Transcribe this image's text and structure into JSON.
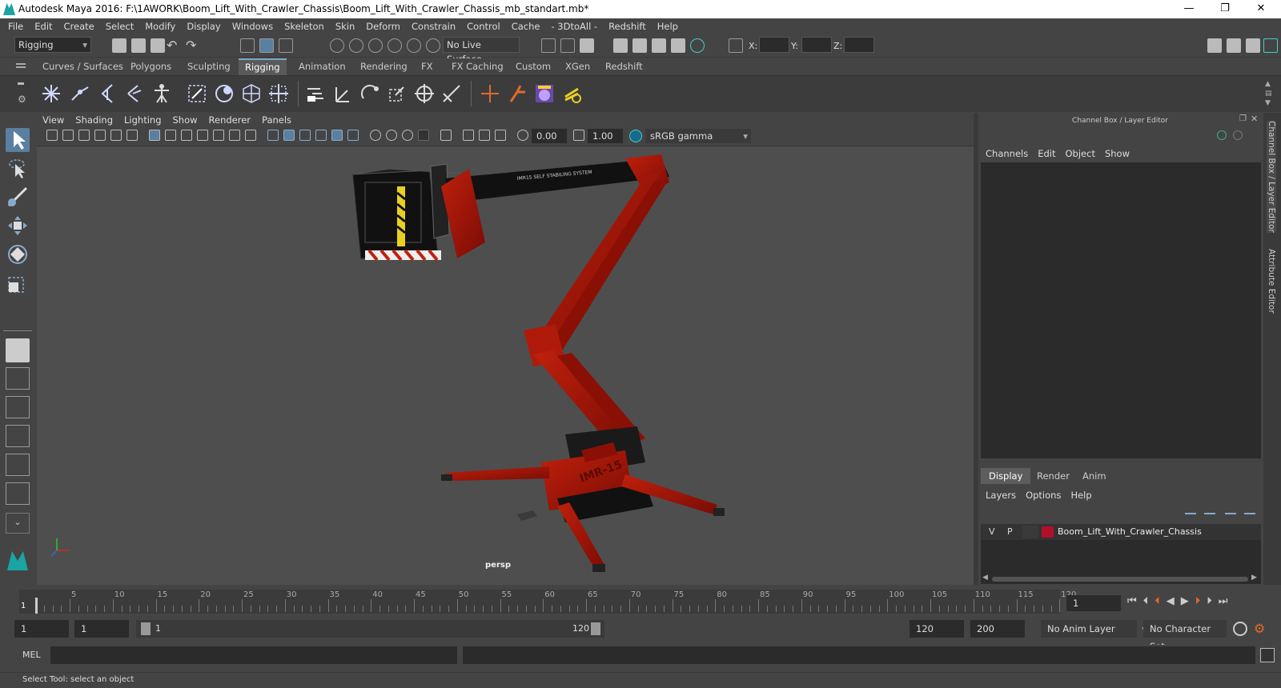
{
  "window": {
    "title": "Autodesk Maya 2016: F:\\1AWORK\\Boom_Lift_With_Crawler_Chassis\\Boom_Lift_With_Crawler_Chassis_mb_standart.mb*",
    "minimize": "—",
    "restore": "❐",
    "close": "✕"
  },
  "menu": [
    "File",
    "Edit",
    "Create",
    "Select",
    "Modify",
    "Display",
    "Windows",
    "Skeleton",
    "Skin",
    "Deform",
    "Constrain",
    "Control",
    "Cache",
    "- 3DtoAll -",
    "Redshift",
    "Help"
  ],
  "toolbar": {
    "mode": "Rigging",
    "live_surface": "No Live Surface",
    "x_label": "X:",
    "y_label": "Y:",
    "z_label": "Z:"
  },
  "shelf_tabs": [
    "Curves / Surfaces",
    "Polygons",
    "Sculpting",
    "Rigging",
    "Animation",
    "Rendering",
    "FX",
    "FX Caching",
    "Custom",
    "XGen",
    "Redshift"
  ],
  "active_shelf": "Rigging",
  "viewport": {
    "menus": [
      "View",
      "Shading",
      "Lighting",
      "Show",
      "Renderer",
      "Panels"
    ],
    "exposure": "0.00",
    "gamma": "1.00",
    "colorspace": "sRGB gamma",
    "camera": "persp",
    "model_text_arm": "IMR15 SELF STABILING SYSTEM",
    "model_text_base": "IMR-15"
  },
  "channel_box": {
    "title": "Channel Box / Layer Editor",
    "menus": [
      "Channels",
      "Edit",
      "Object",
      "Show"
    ]
  },
  "layer_editor": {
    "tabs": [
      "Display",
      "Render",
      "Anim"
    ],
    "active": "Display",
    "menus": [
      "Layers",
      "Options",
      "Help"
    ],
    "layer": {
      "v": "V",
      "p": "P",
      "name": "Boom_Lift_With_Crawler_Chassis",
      "color": "#b0102a"
    }
  },
  "side_tabs": [
    "Channel Box / Layer Editor",
    "Attribute Editor"
  ],
  "timeline": {
    "ticks": [
      "5",
      "10",
      "15",
      "20",
      "25",
      "30",
      "35",
      "40",
      "45",
      "50",
      "55",
      "60",
      "65",
      "70",
      "75",
      "80",
      "85",
      "90",
      "95",
      "100",
      "105",
      "110",
      "115",
      "120"
    ],
    "start_marker": "1",
    "current_frame": "1"
  },
  "range": {
    "start": "1",
    "start2": "1",
    "slider_start": "1",
    "slider_end": "120",
    "end": "120",
    "end2": "200",
    "anim_layer": "No Anim Layer",
    "char_set": "No Character Set"
  },
  "mel": {
    "label": "MEL"
  },
  "status": "Select Tool: select an object",
  "colors": {
    "accent": "#7aa9c9",
    "lift_red": "#a01208",
    "bg": "#444444"
  }
}
